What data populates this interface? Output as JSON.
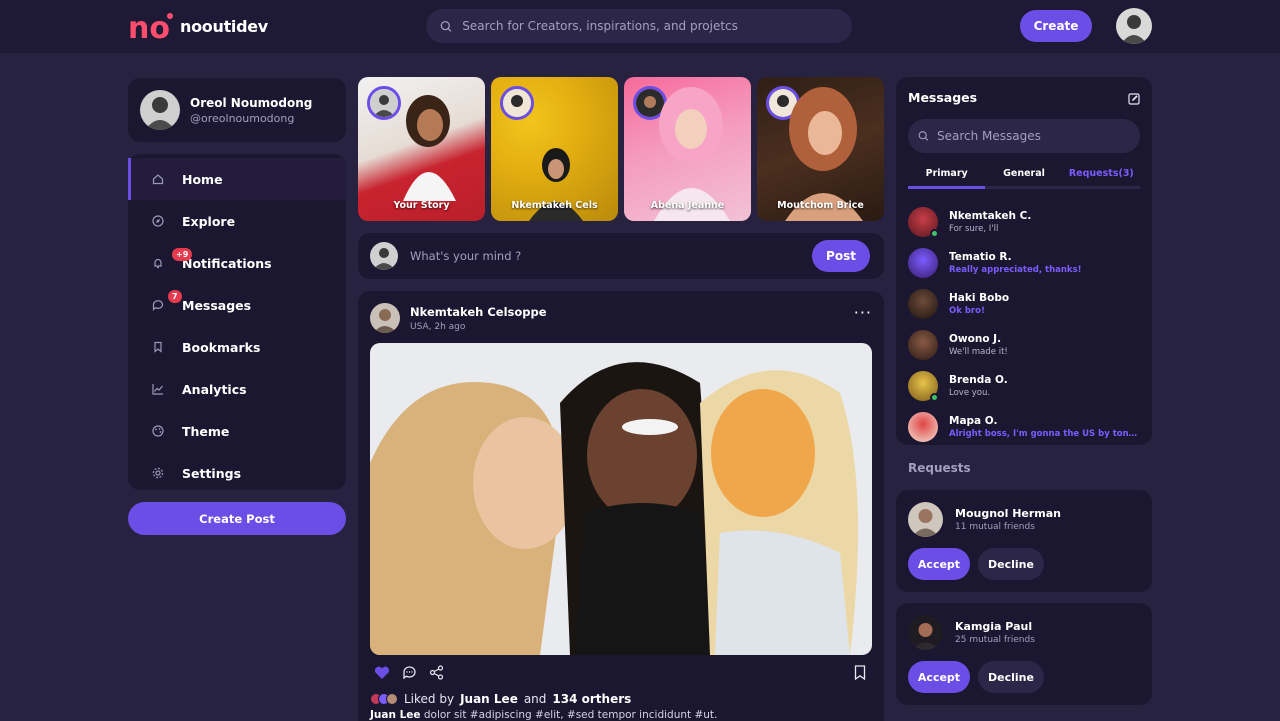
{
  "brand": {
    "name": "nooutidev",
    "accent": "#6b4ee6",
    "logo_color": "#ff4d6d"
  },
  "header": {
    "search_placeholder": "Search for Creators, inspirations, and projetcs",
    "create_label": "Create"
  },
  "profile": {
    "name": "Oreol Noumodong",
    "handle": "@oreolnoumodong"
  },
  "nav": {
    "items": [
      {
        "label": "Home",
        "icon": "home-icon",
        "active": true
      },
      {
        "label": "Explore",
        "icon": "compass-icon"
      },
      {
        "label": "Notifications",
        "icon": "bell-icon",
        "badge": "+9"
      },
      {
        "label": "Messages",
        "icon": "chat-icon",
        "badge": "7"
      },
      {
        "label": "Bookmarks",
        "icon": "bookmark-icon"
      },
      {
        "label": "Analytics",
        "icon": "chart-icon"
      },
      {
        "label": "Theme",
        "icon": "palette-icon"
      },
      {
        "label": "Settings",
        "icon": "gear-icon"
      }
    ],
    "create_post_label": "Create Post"
  },
  "stories": [
    {
      "name": "Your Story"
    },
    {
      "name": "Nkemtakeh Cels"
    },
    {
      "name": "Abena Jeanne"
    },
    {
      "name": "Moutchom Brice"
    }
  ],
  "composer": {
    "placeholder": "What's your mind ?",
    "post_label": "Post"
  },
  "post": {
    "author": "Nkemtakeh Celsoppe",
    "meta": "USA, 2h ago",
    "liked_prefix": "Liked by",
    "liked_user": "Juan Lee",
    "liked_and": "and",
    "liked_others": "134 orthers",
    "caption_user": "Juan Lee",
    "caption_text": "dolor sit #adipiscing #elit, #sed tempor incididunt #ut."
  },
  "messages": {
    "title": "Messages",
    "search_placeholder": "Search Messages",
    "tabs": [
      {
        "label": "Primary",
        "active": true
      },
      {
        "label": "General"
      },
      {
        "label": "Requests(3)"
      }
    ],
    "list": [
      {
        "name": "Nkemtakeh C.",
        "text": "For sure, I'll",
        "unread": false,
        "online": true
      },
      {
        "name": "Tematio R.",
        "text": "Really appreciated, thanks!",
        "unread": true,
        "online": false
      },
      {
        "name": "Haki Bobo",
        "text": "Ok bro!",
        "unread": true,
        "online": false
      },
      {
        "name": "Owono J.",
        "text": "We'll made it!",
        "unread": false,
        "online": false
      },
      {
        "name": "Brenda O.",
        "text": "Love you.",
        "unread": false,
        "online": true
      },
      {
        "name": "Mapa O.",
        "text": "Alright boss, I'm gonna the US by tonight",
        "unread": true,
        "online": false
      }
    ]
  },
  "requests": {
    "title": "Requests",
    "accept_label": "Accept",
    "decline_label": "Decline",
    "items": [
      {
        "name": "Mougnol Herman",
        "mutual": "11 mutual friends"
      },
      {
        "name": "Kamgia Paul",
        "mutual": "25 mutual friends"
      }
    ]
  }
}
